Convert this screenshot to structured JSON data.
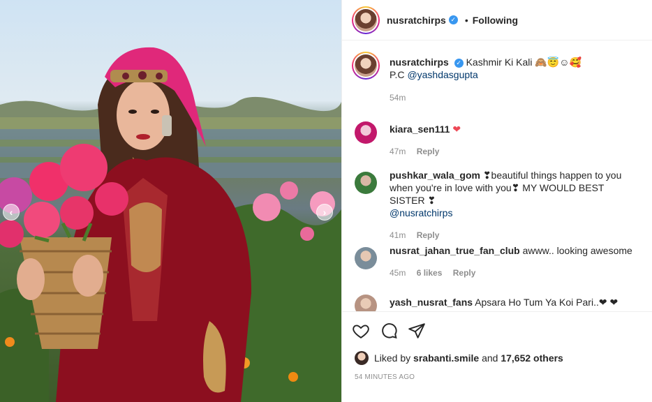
{
  "post": {
    "username": "nusratchirps",
    "follow_label": "Following",
    "dot": "•",
    "verified": "✓"
  },
  "caption": {
    "username": "nusratchirps",
    "text": "Kashmir Ki Kali 🙈😇☺🥰",
    "credit_prefix": "P.C ",
    "credit_handle": "@yashdasgupta",
    "time": "54m"
  },
  "comments": [
    {
      "username": "kiara_sen111",
      "text": "❤",
      "time": "47m",
      "reply": "Reply",
      "avatar_color": "#c2186b"
    },
    {
      "username": "pushkar_wala_gom",
      "text": "❣beautiful things happen to you when you're in love with you❣ MY WOULD BEST SISTER ❣",
      "mention": "@nusratchirps",
      "time": "41m",
      "reply": "Reply",
      "avatar_color": "#3b7a3c"
    },
    {
      "username": "nusrat_jahan_true_fan_club",
      "text": "awww.. looking awesome",
      "time": "45m",
      "likes": "6 likes",
      "reply": "Reply",
      "avatar_color": "#7a8d9a"
    },
    {
      "username": "yash_nusrat_fans",
      "text": "Apsara Ho Tum Ya Koi Pari..❤ ❤",
      "avatar_color": "#b79382"
    }
  ],
  "likes": {
    "prefix": "Liked by ",
    "user": "srabanti.smile",
    "middle": " and ",
    "count": "17,652 others"
  },
  "timestamp": "54 MINUTES AGO",
  "nav": {
    "prev": "‹",
    "next": "›"
  },
  "colors": {
    "verified": "#3897f0",
    "link": "#00376b",
    "heart": "#ed4956"
  }
}
